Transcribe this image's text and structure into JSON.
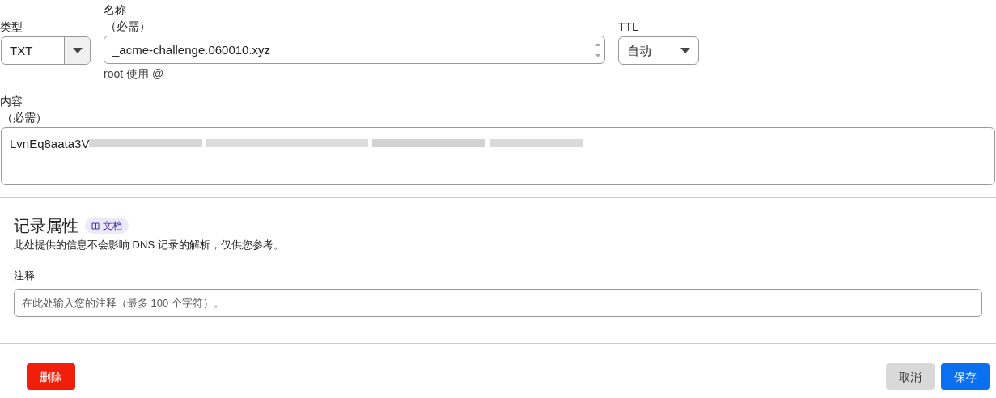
{
  "type_field": {
    "label": "类型",
    "value": "TXT"
  },
  "name_field": {
    "label": "名称",
    "required": "（必需）",
    "value": "_acme-challenge.060010.xyz",
    "hint": "root 使用 @"
  },
  "ttl_field": {
    "label": "TTL",
    "value": "自动"
  },
  "content_field": {
    "label": "内容",
    "required": "（必需）",
    "value": "LvnEq8aata3V"
  },
  "record_attributes": {
    "title": "记录属性",
    "docs_badge": "文档",
    "description": "此处提供的信息不会影响 DNS 记录的解析，仅供您参考。"
  },
  "comment_field": {
    "label": "注释",
    "placeholder": "在此处输入您的注释（最多 100 个字符）。"
  },
  "buttons": [
    {
      "kind": "danger",
      "label": "删除"
    },
    {
      "kind": "secondary",
      "label": "取消"
    },
    {
      "kind": "primary",
      "label": "保存"
    }
  ]
}
